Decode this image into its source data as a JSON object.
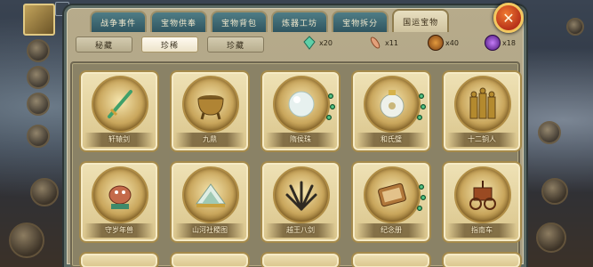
{
  "tabs": [
    {
      "label": "战争事件"
    },
    {
      "label": "宝物供奉"
    },
    {
      "label": "宝物背包"
    },
    {
      "label": "炼器工坊"
    },
    {
      "label": "宝物拆分"
    },
    {
      "label": "国运宝物",
      "active": true
    }
  ],
  "close_button": {
    "icon": "close-icon",
    "glyph": "✕"
  },
  "sub_tabs": [
    {
      "label": "秘藏"
    },
    {
      "label": "珍稀",
      "active": true
    },
    {
      "label": "珍藏"
    }
  ],
  "resources": [
    {
      "icon": "crystal-icon",
      "count": "x20",
      "color": "#5fd0a8"
    },
    {
      "icon": "feather-icon",
      "count": "x11",
      "color": "#e2a07a"
    },
    {
      "icon": "seal-icon",
      "count": "x40",
      "color": "#c9731e"
    },
    {
      "icon": "orb-icon",
      "count": "x18",
      "color": "#8a3fd4"
    }
  ],
  "items": [
    {
      "name": "轩辕剑",
      "icon": "sword-icon",
      "gems": 0
    },
    {
      "name": "九鼎",
      "icon": "cauldron-icon",
      "gems": 0
    },
    {
      "name": "隋侯珠",
      "icon": "pearl-icon",
      "gems": 3
    },
    {
      "name": "和氏璧",
      "icon": "jade-disc-icon",
      "gems": 3
    },
    {
      "name": "十二铜人",
      "icon": "bronze-men-icon",
      "gems": 0
    },
    {
      "name": "守岁年兽",
      "icon": "beast-icon",
      "gems": 0
    },
    {
      "name": "山河社稷图",
      "icon": "scroll-map-icon",
      "gems": 0
    },
    {
      "name": "越王八剑",
      "icon": "swords-icon",
      "gems": 0
    },
    {
      "name": "纪念册",
      "icon": "album-icon",
      "gems": 3
    },
    {
      "name": "指南车",
      "icon": "chariot-icon",
      "gems": 0
    }
  ],
  "colors": {
    "tab_inactive": "#2f5560",
    "tab_active": "#e8dfc0",
    "card_bg": "#e6d6a2",
    "close_button": "#d2461f"
  }
}
